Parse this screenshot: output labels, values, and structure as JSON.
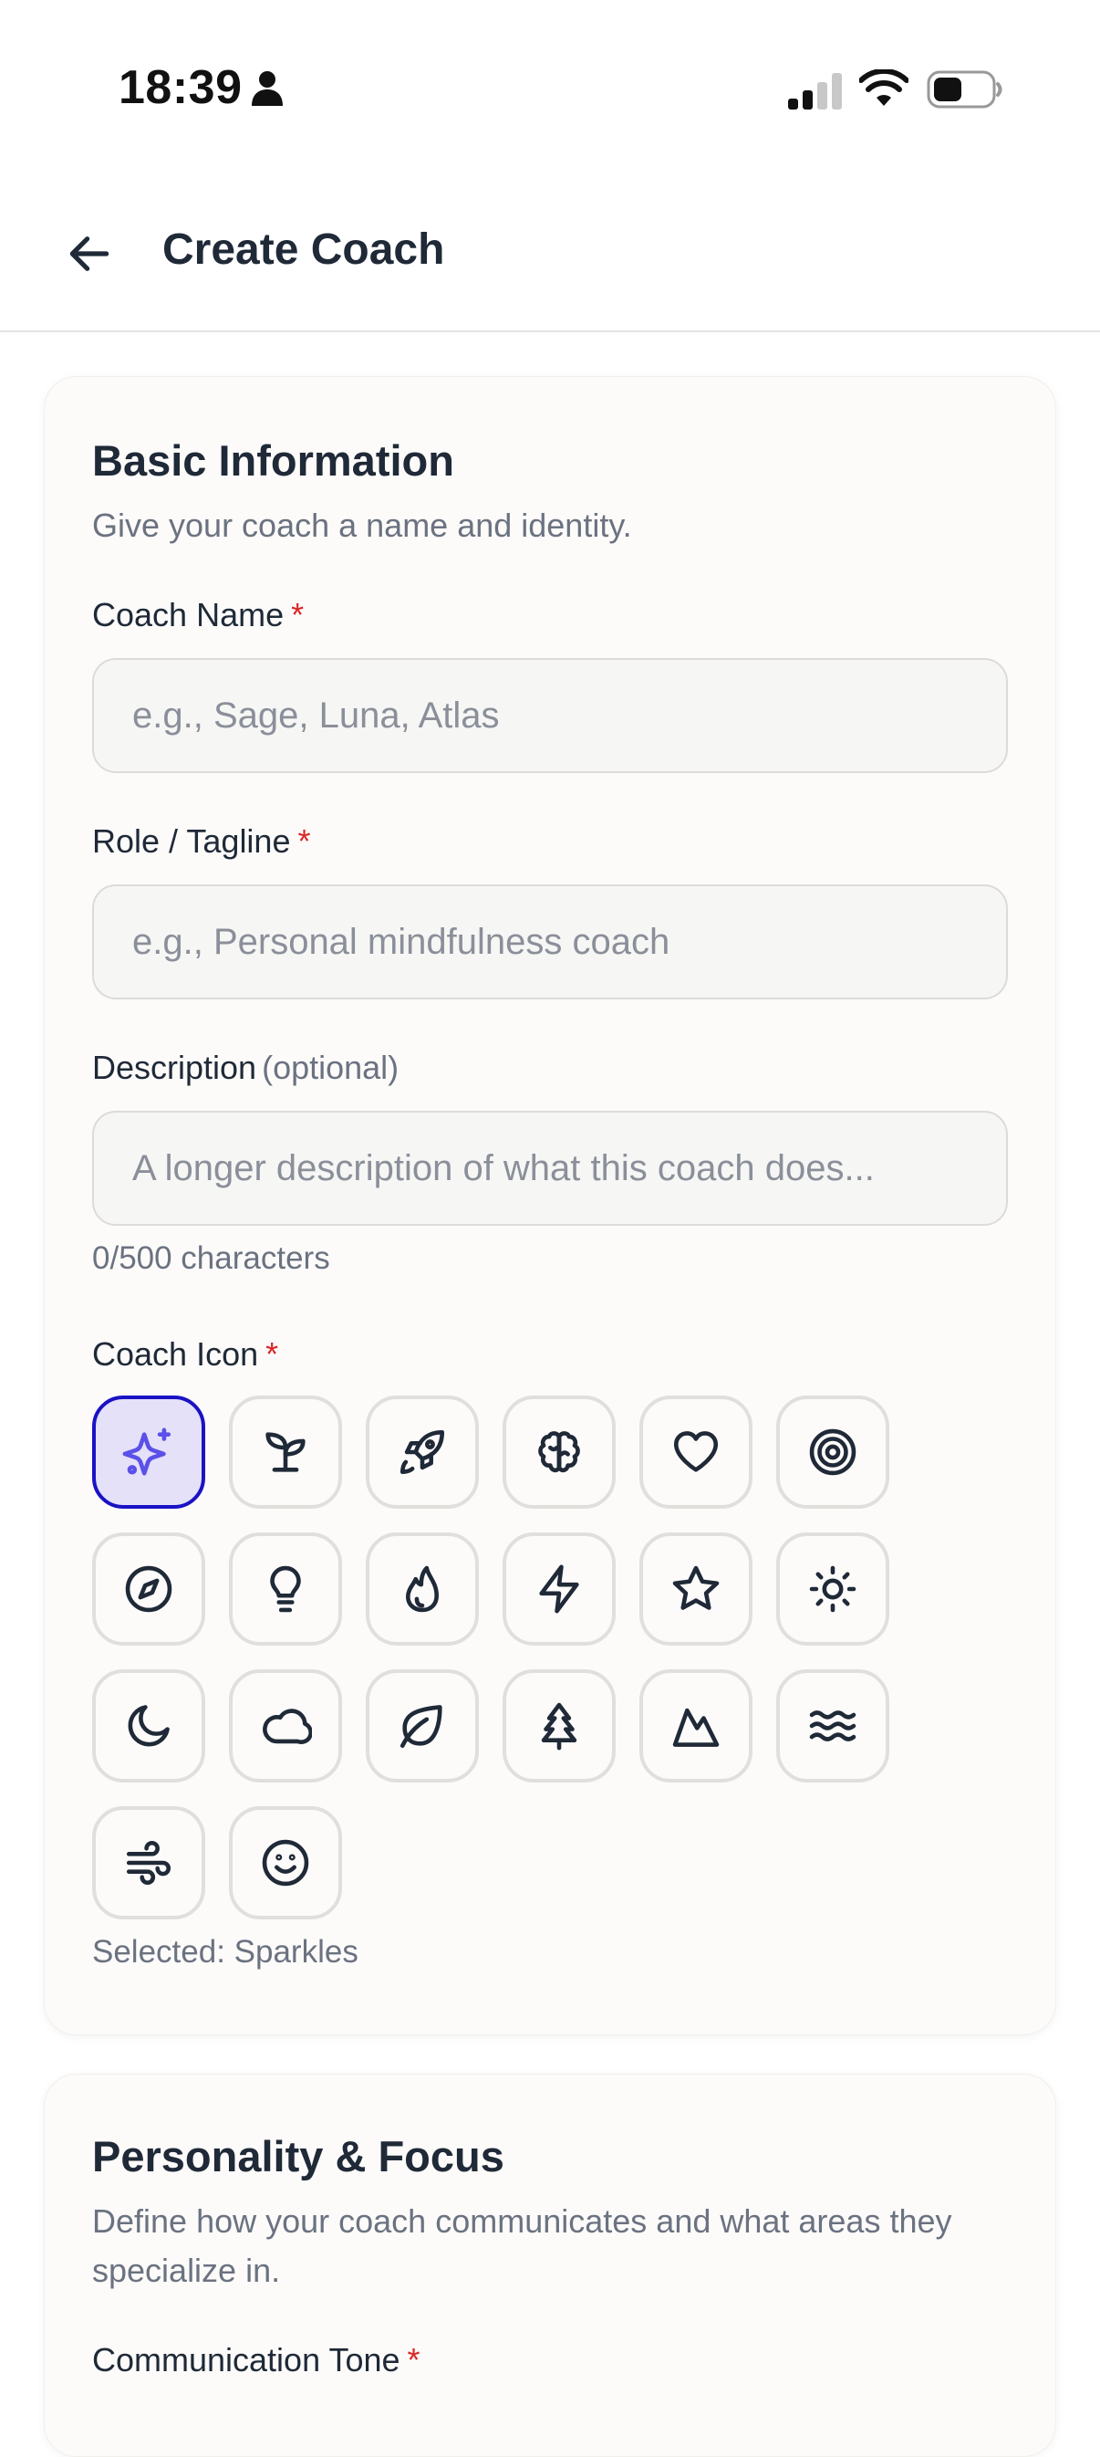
{
  "status_bar": {
    "time": "18:39"
  },
  "header": {
    "title": "Create Coach"
  },
  "basic_info": {
    "title": "Basic Information",
    "description": "Give your coach a name and identity.",
    "coach_name": {
      "label": "Coach Name",
      "required_mark": "*",
      "placeholder": "e.g., Sage, Luna, Atlas",
      "value": ""
    },
    "role": {
      "label": "Role / Tagline",
      "required_mark": "*",
      "placeholder": "e.g., Personal mindfulness coach",
      "value": ""
    },
    "description_field": {
      "label": "Description",
      "optional_hint": "(optional)",
      "placeholder": "A longer description of what this coach does...",
      "value": "",
      "char_count": "0/500 characters"
    },
    "coach_icon": {
      "label": "Coach Icon",
      "required_mark": "*",
      "selected_text": "Selected: Sparkles",
      "selected_icon": "sparkles-icon",
      "icons": [
        "sparkles-icon",
        "sprout-icon",
        "rocket-icon",
        "brain-icon",
        "heart-icon",
        "target-icon",
        "compass-icon",
        "lightbulb-icon",
        "flame-icon",
        "zap-icon",
        "star-icon",
        "sun-icon",
        "moon-icon",
        "cloud-icon",
        "leaf-icon",
        "tree-icon",
        "mountain-icon",
        "waves-icon",
        "wind-icon",
        "smile-icon"
      ]
    }
  },
  "personality": {
    "title": "Personality & Focus",
    "description": "Define how your coach communicates and what areas they specialize in.",
    "tone": {
      "label": "Communication Tone",
      "required_mark": "*"
    }
  },
  "colors": {
    "accent": "#1a12c4",
    "accent_light": "#e4e1f9",
    "required": "#dc2626"
  }
}
